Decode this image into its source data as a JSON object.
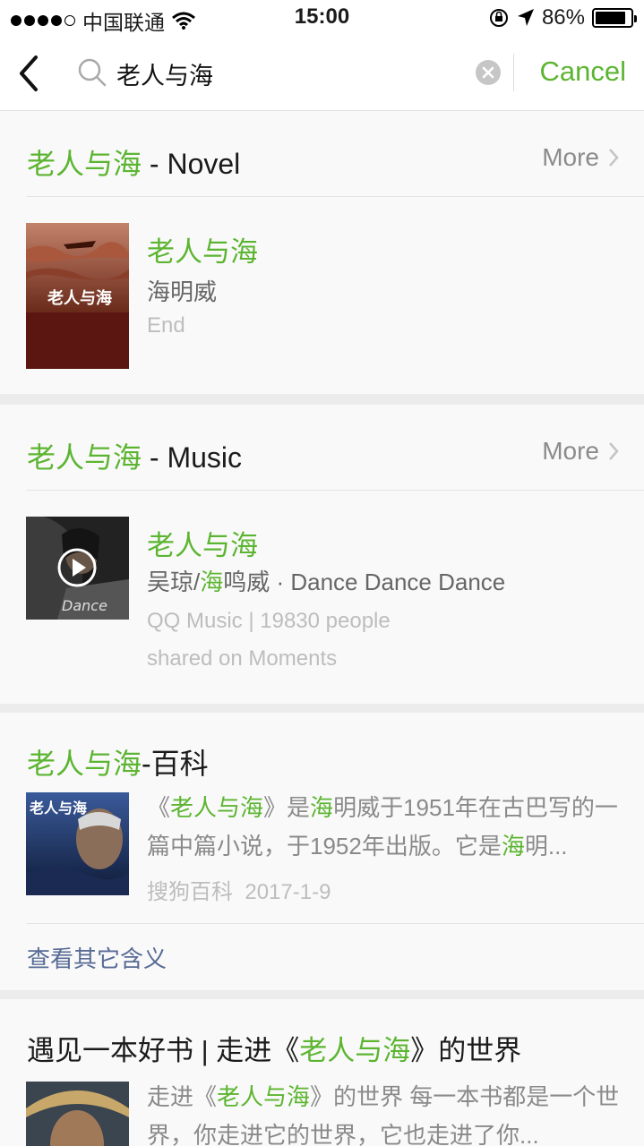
{
  "status": {
    "carrier": "中国联通",
    "time": "15:00",
    "battery": "86%",
    "battery_level": 0.86
  },
  "search": {
    "query": "老人与海",
    "cancel_label": "Cancel"
  },
  "novel": {
    "keyword": "老人与海",
    "suffix": " - Novel",
    "more": "More",
    "cover_text": "老人与海",
    "title": "老人与海",
    "author": "海明威",
    "status": "End"
  },
  "music": {
    "keyword": "老人与海",
    "suffix": " - Music",
    "more": "More",
    "title": "老人与海",
    "artist_a": "吴琼/",
    "artist_hl": "海",
    "artist_b": "鸣威 · Dance Dance Dance",
    "meta_line1": "QQ Music | 19830 people",
    "meta_line2": "shared on Moments"
  },
  "baike": {
    "keyword": "老人与海",
    "suffix": "-百科",
    "cover_text": "老人与海",
    "desc": [
      {
        "t": "《",
        "hl": false
      },
      {
        "t": "老人与海",
        "hl": true
      },
      {
        "t": "》是",
        "hl": false
      },
      {
        "t": "海",
        "hl": true
      },
      {
        "t": "明威于1951年在古巴写的一篇中篇小说，于1952年出版。它是",
        "hl": false
      },
      {
        "t": "海",
        "hl": true
      },
      {
        "t": "明...",
        "hl": false
      }
    ],
    "source": "搜狗百科",
    "date": "2017-1-9",
    "other_meanings": "查看其它含义"
  },
  "article": {
    "title_a": "遇见一本好书 | 走进《",
    "title_hl": "老人与海",
    "title_b": "》的世界",
    "desc": [
      {
        "t": "走进《",
        "hl": false
      },
      {
        "t": "老人与海",
        "hl": true
      },
      {
        "t": "》的世界 每一本书都是一个世界，你走进它的世界，它也走进了你...",
        "hl": false
      }
    ]
  }
}
